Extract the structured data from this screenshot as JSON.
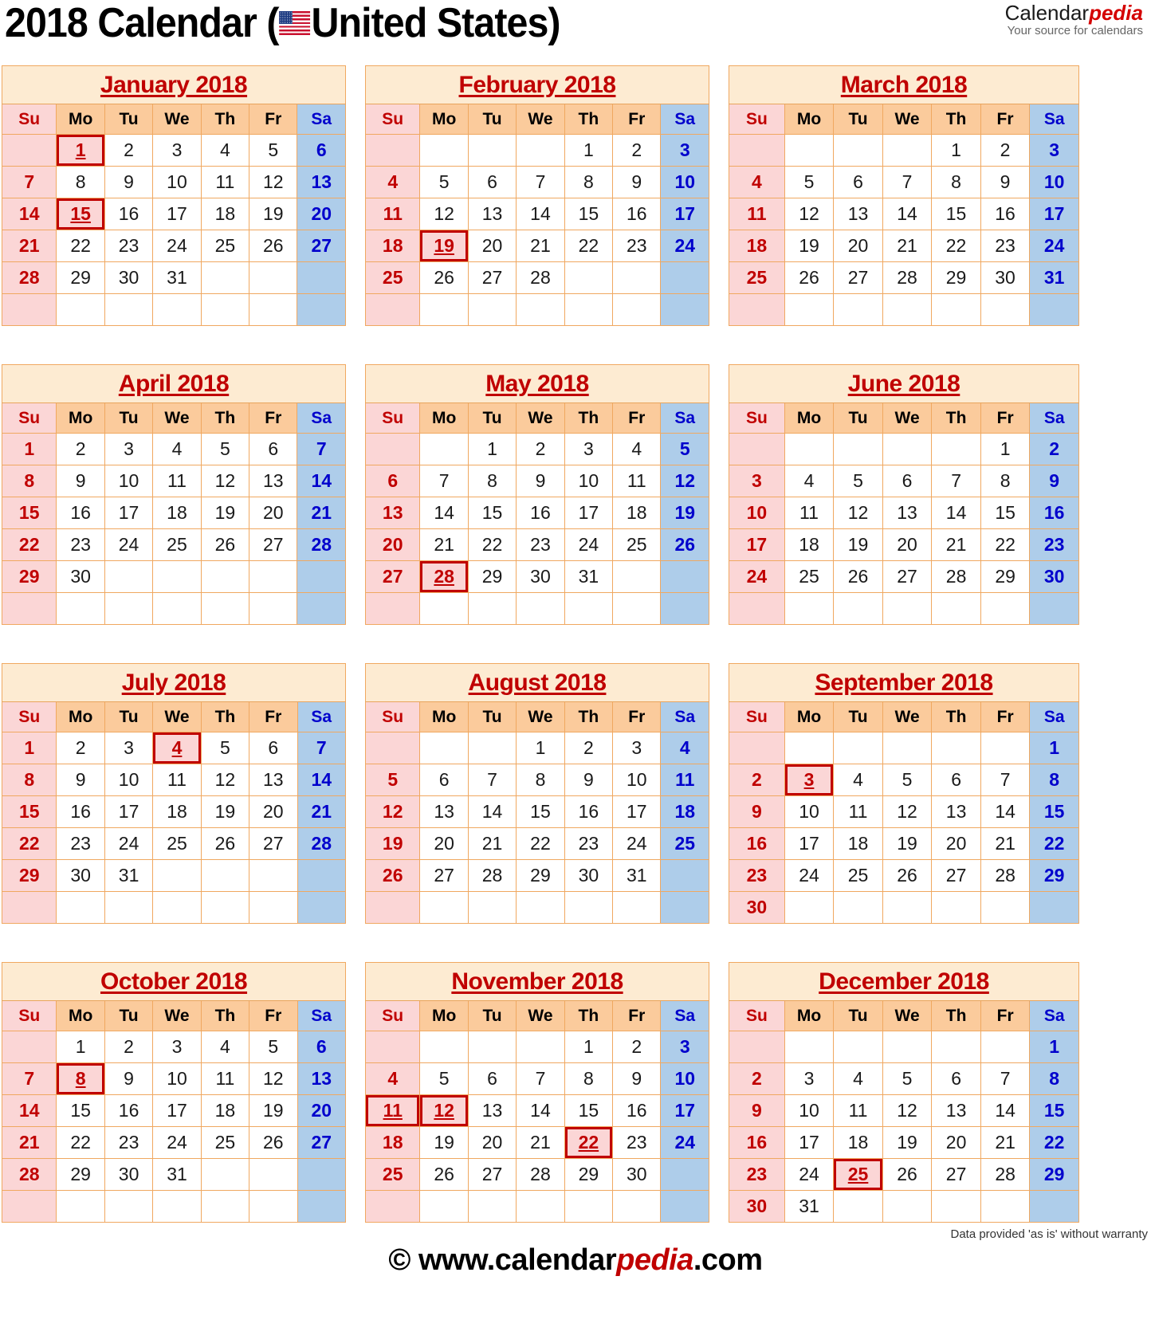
{
  "header": {
    "title_before_flag": "2018 Calendar (",
    "flag_icon": "us-flag-icon",
    "title_after_flag": "United States)",
    "brand_name_part1": "Calendar",
    "brand_name_part2": "pedia",
    "brand_tagline": "Your source for calendars"
  },
  "weekday_headers": [
    "Su",
    "Mo",
    "Tu",
    "We",
    "Th",
    "Fr",
    "Sa"
  ],
  "colors": {
    "title_text": "#000000",
    "month_title": "#c00000",
    "sunday_bg": "#fbd6d6",
    "sunday_text": "#c00000",
    "saturday_bg": "#aecdea",
    "saturday_text": "#0000cc",
    "weekday_header_bg": "#fbcb9c",
    "month_header_bg": "#fdebd2",
    "grid_border": "#f0a860",
    "holiday_outline": "#c00000",
    "brand_accent": "#d40000"
  },
  "months": [
    {
      "name": "January 2018",
      "weeks": [
        [
          "",
          "1",
          "2",
          "3",
          "4",
          "5",
          "6"
        ],
        [
          "7",
          "8",
          "9",
          "10",
          "11",
          "12",
          "13"
        ],
        [
          "14",
          "15",
          "16",
          "17",
          "18",
          "19",
          "20"
        ],
        [
          "21",
          "22",
          "23",
          "24",
          "25",
          "26",
          "27"
        ],
        [
          "28",
          "29",
          "30",
          "31",
          "",
          "",
          ""
        ],
        [
          "",
          "",
          "",
          "",
          "",
          "",
          ""
        ]
      ],
      "holidays": [
        "1",
        "15"
      ]
    },
    {
      "name": "February 2018",
      "weeks": [
        [
          "",
          "",
          "",
          "",
          "1",
          "2",
          "3"
        ],
        [
          "4",
          "5",
          "6",
          "7",
          "8",
          "9",
          "10"
        ],
        [
          "11",
          "12",
          "13",
          "14",
          "15",
          "16",
          "17"
        ],
        [
          "18",
          "19",
          "20",
          "21",
          "22",
          "23",
          "24"
        ],
        [
          "25",
          "26",
          "27",
          "28",
          "",
          "",
          ""
        ],
        [
          "",
          "",
          "",
          "",
          "",
          "",
          ""
        ]
      ],
      "holidays": [
        "19"
      ]
    },
    {
      "name": "March 2018",
      "weeks": [
        [
          "",
          "",
          "",
          "",
          "1",
          "2",
          "3"
        ],
        [
          "4",
          "5",
          "6",
          "7",
          "8",
          "9",
          "10"
        ],
        [
          "11",
          "12",
          "13",
          "14",
          "15",
          "16",
          "17"
        ],
        [
          "18",
          "19",
          "20",
          "21",
          "22",
          "23",
          "24"
        ],
        [
          "25",
          "26",
          "27",
          "28",
          "29",
          "30",
          "31"
        ],
        [
          "",
          "",
          "",
          "",
          "",
          "",
          ""
        ]
      ],
      "holidays": []
    },
    {
      "name": "April 2018",
      "weeks": [
        [
          "1",
          "2",
          "3",
          "4",
          "5",
          "6",
          "7"
        ],
        [
          "8",
          "9",
          "10",
          "11",
          "12",
          "13",
          "14"
        ],
        [
          "15",
          "16",
          "17",
          "18",
          "19",
          "20",
          "21"
        ],
        [
          "22",
          "23",
          "24",
          "25",
          "26",
          "27",
          "28"
        ],
        [
          "29",
          "30",
          "",
          "",
          "",
          "",
          ""
        ],
        [
          "",
          "",
          "",
          "",
          "",
          "",
          ""
        ]
      ],
      "holidays": []
    },
    {
      "name": "May 2018",
      "weeks": [
        [
          "",
          "",
          "1",
          "2",
          "3",
          "4",
          "5"
        ],
        [
          "6",
          "7",
          "8",
          "9",
          "10",
          "11",
          "12"
        ],
        [
          "13",
          "14",
          "15",
          "16",
          "17",
          "18",
          "19"
        ],
        [
          "20",
          "21",
          "22",
          "23",
          "24",
          "25",
          "26"
        ],
        [
          "27",
          "28",
          "29",
          "30",
          "31",
          "",
          ""
        ],
        [
          "",
          "",
          "",
          "",
          "",
          "",
          ""
        ]
      ],
      "holidays": [
        "28"
      ]
    },
    {
      "name": "June 2018",
      "weeks": [
        [
          "",
          "",
          "",
          "",
          "",
          "1",
          "2"
        ],
        [
          "3",
          "4",
          "5",
          "6",
          "7",
          "8",
          "9"
        ],
        [
          "10",
          "11",
          "12",
          "13",
          "14",
          "15",
          "16"
        ],
        [
          "17",
          "18",
          "19",
          "20",
          "21",
          "22",
          "23"
        ],
        [
          "24",
          "25",
          "26",
          "27",
          "28",
          "29",
          "30"
        ],
        [
          "",
          "",
          "",
          "",
          "",
          "",
          ""
        ]
      ],
      "holidays": []
    },
    {
      "name": "July 2018",
      "weeks": [
        [
          "1",
          "2",
          "3",
          "4",
          "5",
          "6",
          "7"
        ],
        [
          "8",
          "9",
          "10",
          "11",
          "12",
          "13",
          "14"
        ],
        [
          "15",
          "16",
          "17",
          "18",
          "19",
          "20",
          "21"
        ],
        [
          "22",
          "23",
          "24",
          "25",
          "26",
          "27",
          "28"
        ],
        [
          "29",
          "30",
          "31",
          "",
          "",
          "",
          ""
        ],
        [
          "",
          "",
          "",
          "",
          "",
          "",
          ""
        ]
      ],
      "holidays": [
        "4"
      ]
    },
    {
      "name": "August 2018",
      "weeks": [
        [
          "",
          "",
          "",
          "1",
          "2",
          "3",
          "4"
        ],
        [
          "5",
          "6",
          "7",
          "8",
          "9",
          "10",
          "11"
        ],
        [
          "12",
          "13",
          "14",
          "15",
          "16",
          "17",
          "18"
        ],
        [
          "19",
          "20",
          "21",
          "22",
          "23",
          "24",
          "25"
        ],
        [
          "26",
          "27",
          "28",
          "29",
          "30",
          "31",
          ""
        ],
        [
          "",
          "",
          "",
          "",
          "",
          "",
          ""
        ]
      ],
      "holidays": []
    },
    {
      "name": "September 2018",
      "weeks": [
        [
          "",
          "",
          "",
          "",
          "",
          "",
          "1"
        ],
        [
          "2",
          "3",
          "4",
          "5",
          "6",
          "7",
          "8"
        ],
        [
          "9",
          "10",
          "11",
          "12",
          "13",
          "14",
          "15"
        ],
        [
          "16",
          "17",
          "18",
          "19",
          "20",
          "21",
          "22"
        ],
        [
          "23",
          "24",
          "25",
          "26",
          "27",
          "28",
          "29"
        ],
        [
          "30",
          "",
          "",
          "",
          "",
          "",
          ""
        ]
      ],
      "holidays": [
        "3"
      ]
    },
    {
      "name": "October 2018",
      "weeks": [
        [
          "",
          "1",
          "2",
          "3",
          "4",
          "5",
          "6"
        ],
        [
          "7",
          "8",
          "9",
          "10",
          "11",
          "12",
          "13"
        ],
        [
          "14",
          "15",
          "16",
          "17",
          "18",
          "19",
          "20"
        ],
        [
          "21",
          "22",
          "23",
          "24",
          "25",
          "26",
          "27"
        ],
        [
          "28",
          "29",
          "30",
          "31",
          "",
          "",
          ""
        ],
        [
          "",
          "",
          "",
          "",
          "",
          "",
          ""
        ]
      ],
      "holidays": [
        "8"
      ]
    },
    {
      "name": "November 2018",
      "weeks": [
        [
          "",
          "",
          "",
          "",
          "1",
          "2",
          "3"
        ],
        [
          "4",
          "5",
          "6",
          "7",
          "8",
          "9",
          "10"
        ],
        [
          "11",
          "12",
          "13",
          "14",
          "15",
          "16",
          "17"
        ],
        [
          "18",
          "19",
          "20",
          "21",
          "22",
          "23",
          "24"
        ],
        [
          "25",
          "26",
          "27",
          "28",
          "29",
          "30",
          ""
        ],
        [
          "",
          "",
          "",
          "",
          "",
          "",
          ""
        ]
      ],
      "holidays": [
        "11",
        "12",
        "22"
      ]
    },
    {
      "name": "December 2018",
      "weeks": [
        [
          "",
          "",
          "",
          "",
          "",
          "",
          "1"
        ],
        [
          "2",
          "3",
          "4",
          "5",
          "6",
          "7",
          "8"
        ],
        [
          "9",
          "10",
          "11",
          "12",
          "13",
          "14",
          "15"
        ],
        [
          "16",
          "17",
          "18",
          "19",
          "20",
          "21",
          "22"
        ],
        [
          "23",
          "24",
          "25",
          "26",
          "27",
          "28",
          "29"
        ],
        [
          "30",
          "31",
          "",
          "",
          "",
          "",
          ""
        ]
      ],
      "holidays": [
        "25"
      ]
    }
  ],
  "footer": {
    "disclaimer": "Data provided 'as is' without warranty",
    "copyright_symbol": "©",
    "url_prefix": " www.calendar",
    "url_accent": "pedia",
    "url_suffix": ".com"
  }
}
